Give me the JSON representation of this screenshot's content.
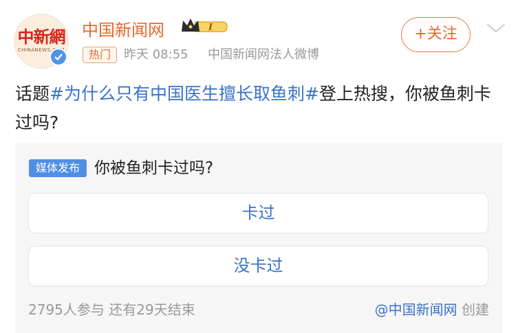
{
  "header": {
    "avatar_logo": "中新網",
    "avatar_sub": "CHINANEWS.COM",
    "account_name": "中国新闻网",
    "hot_tag": "热门",
    "time": "昨天 08:55",
    "source": "中国新闻网法人微博",
    "follow_label": "+关注",
    "level_badge": "I"
  },
  "post": {
    "prefix": "话题",
    "topic": "#为什么只有中国医生擅长取鱼刺#",
    "suffix": "登上热搜，你被鱼刺卡过吗?"
  },
  "poll": {
    "badge": "媒体发布",
    "question": "你被鱼刺卡过吗?",
    "options": [
      {
        "label": "卡过"
      },
      {
        "label": "没卡过"
      }
    ],
    "stats": "2795人参与  还有29天结束",
    "creator_mention": "@中国新闻网",
    "creator_suffix": " 创建"
  },
  "colors": {
    "brand_orange": "#e8672b",
    "link_blue": "#3a72c8",
    "verified_blue": "#4f95ea"
  },
  "icons": [
    "crown-level-badge-icon",
    "verified-icon",
    "chevron-down-icon"
  ]
}
